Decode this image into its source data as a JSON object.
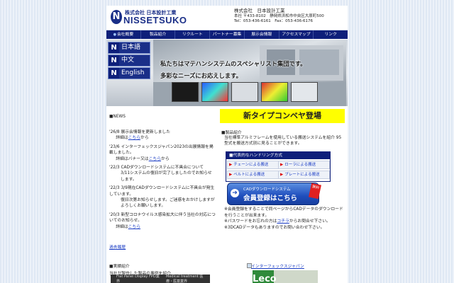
{
  "header": {
    "logo_jp": "株式会社 日本設計工業",
    "logo_en": "NISSETSUKO",
    "company_name": "株式会社　日本設計工業",
    "address": "本社 〒433-8102　静岡県浜松市中央区大原町500",
    "phone": "Tel：053-436-6161　Fax：053-436-6176"
  },
  "nav": {
    "items": [
      "会社概要",
      "製品紹介",
      "リクルート",
      "パートナー募集",
      "展示会情報",
      "アクセスマップ",
      "リンク"
    ]
  },
  "languages": [
    "日本語",
    "中文",
    "English"
  ],
  "banner": {
    "tagline1": "私たちはマテハンシステムのスペシャリスト集団です。",
    "tagline2": "多彩なニーズにお応えします。"
  },
  "news": {
    "heading": "■NEWS",
    "items": [
      {
        "text1": "'26/8 展示会情報を更新しました",
        "text2": "詳細は",
        "link": "こちら",
        "tail": "から"
      },
      {
        "text1": "'23/6 インターフェックスジャパン2023の出展情報を掲載しました。",
        "text2": "詳細はバナー又は",
        "link": "こちら",
        "tail": "から"
      },
      {
        "text1": "'22/3 CADダウンロードシステムに不具合について",
        "text2": "3/11システムの復旧が完了しましたのでお知らせします。",
        "link": "",
        "tail": ""
      },
      {
        "text1": "'22/3 3/9現在CADダウンロードシステムに不具合が発生しています。",
        "text2": "復旧次第お知らせします。ご迷惑をおかけしますがよろしくお願いします。",
        "link": "",
        "tail": ""
      },
      {
        "text1": "'20/3 新型コロナウイルス感染拡大に伴う当社の対応についてのお知らせ。",
        "text2": "詳細は",
        "link": "こちら",
        "tail": ""
      }
    ],
    "archive_link": "過去履歴"
  },
  "works": {
    "heading": "■実績紹介",
    "text": "当社が製作した製品の事例を紹介",
    "thumbs": [
      "Flat Panel Display FPD業界",
      "Medical treatment 医療・医薬業界"
    ]
  },
  "promo": {
    "title": "新タイプコンベヤ登場"
  },
  "products": {
    "heading": "■製品紹介",
    "text": "当社標準アルミフレームを使用している搬送システムを紹介 95型式を搬送方式別に見ることができます。",
    "box_title": "代表的なハンドリング方式",
    "items": [
      "チェーンによる搬送",
      "ローラによる搬送",
      "ベルトによる搬送",
      "プレートによる搬送"
    ]
  },
  "cad": {
    "line1": "CADダウンロードシステム",
    "line2": "会員登録はこちら",
    "free": "無料",
    "note1": "※会員登録をすることで同ページからCADデータのダウンロードを行うことが出来ます。",
    "note2": "※パスワードをお忘れの方は",
    "note2_link": "コチラ",
    "note2_tail": "からお問合せ下さい。",
    "note3": "※3DCADデータもありますのでお問い合わせ下さい。"
  },
  "side_banners": {
    "interphex": "インターフェックスジャパン",
    "leco_logo": "Leco"
  },
  "colors": {
    "nav": "#0e1f7a",
    "promo_bg": "#ffff00",
    "link": "#1a3cc4"
  }
}
